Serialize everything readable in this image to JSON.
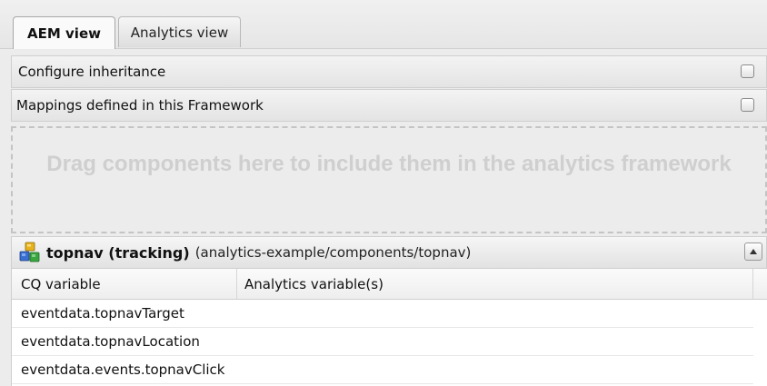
{
  "tabs": [
    {
      "label": "AEM view",
      "active": true
    },
    {
      "label": "Analytics view",
      "active": false
    }
  ],
  "options": {
    "configure_inheritance": {
      "label": "Configure inheritance",
      "checked": false
    },
    "mappings_defined": {
      "label": "Mappings defined in this Framework",
      "checked": false
    }
  },
  "dropzone": {
    "text": "Drag components here to include them in the analytics framework"
  },
  "component": {
    "title": "topnav (tracking)",
    "path": "(analytics-example/components/topnav)",
    "icon": "component-cubes-icon"
  },
  "table": {
    "columns": [
      "CQ variable",
      "Analytics variable(s)"
    ],
    "rows": [
      {
        "cq": "eventdata.topnavTarget",
        "analytics": ""
      },
      {
        "cq": "eventdata.topnavLocation",
        "analytics": ""
      },
      {
        "cq": "eventdata.events.topnavClick",
        "analytics": ""
      }
    ]
  },
  "colors": {
    "background": "#ececec",
    "dropzone_text": "#cfcfcf",
    "border": "#cfcfcf"
  }
}
